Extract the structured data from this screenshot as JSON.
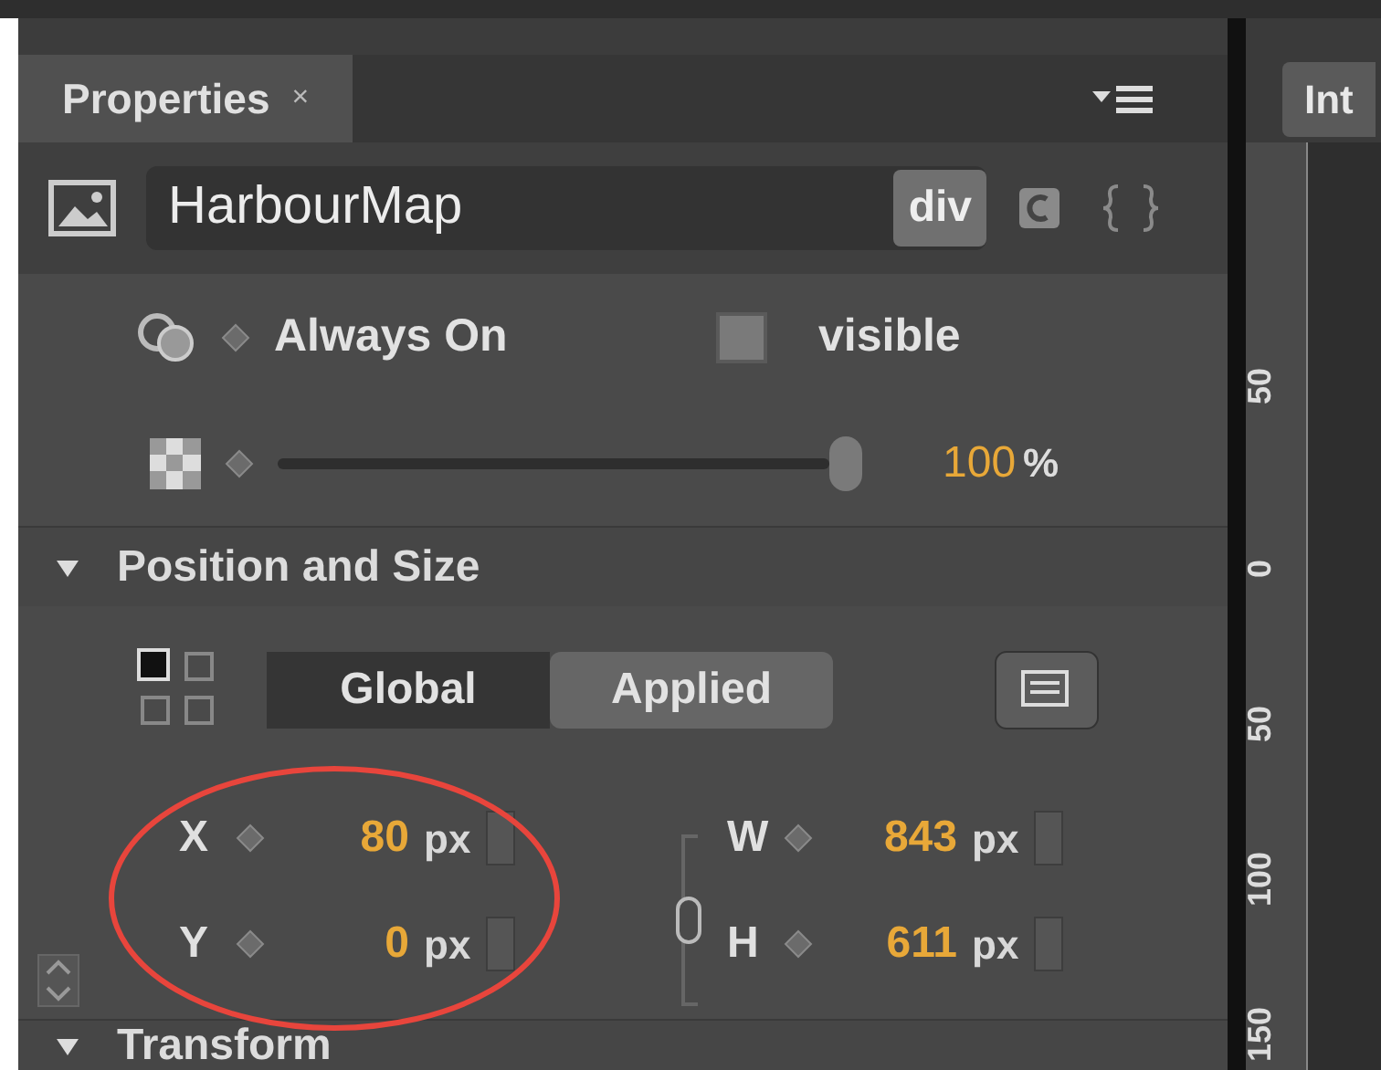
{
  "panel_tab": {
    "label": "Properties",
    "close": "×"
  },
  "element": {
    "name": "HarbourMap",
    "tag": "div"
  },
  "display": {
    "value": "Always On"
  },
  "overflow": {
    "value": "visible"
  },
  "opacity": {
    "level": 1,
    "value": "100",
    "unit": "%"
  },
  "sections": [
    {
      "title": "Position and Size",
      "expanded": true
    },
    {
      "title": "Transform",
      "expanded": true
    }
  ],
  "coordinate_modes": [
    {
      "label": "Global",
      "selected": false
    },
    {
      "label": "Applied",
      "selected": true
    }
  ],
  "fields": [
    {
      "label": "X",
      "value": "80",
      "unit": "px"
    },
    {
      "label": "W",
      "value": "843",
      "unit": "px"
    },
    {
      "label": "Y",
      "value": "0",
      "unit": "px"
    },
    {
      "label": "H",
      "value": "611",
      "unit": "px"
    }
  ],
  "stage_tab": {
    "label": "Int"
  },
  "ruler": [
    "50",
    "0",
    "50",
    "100",
    "150"
  ]
}
